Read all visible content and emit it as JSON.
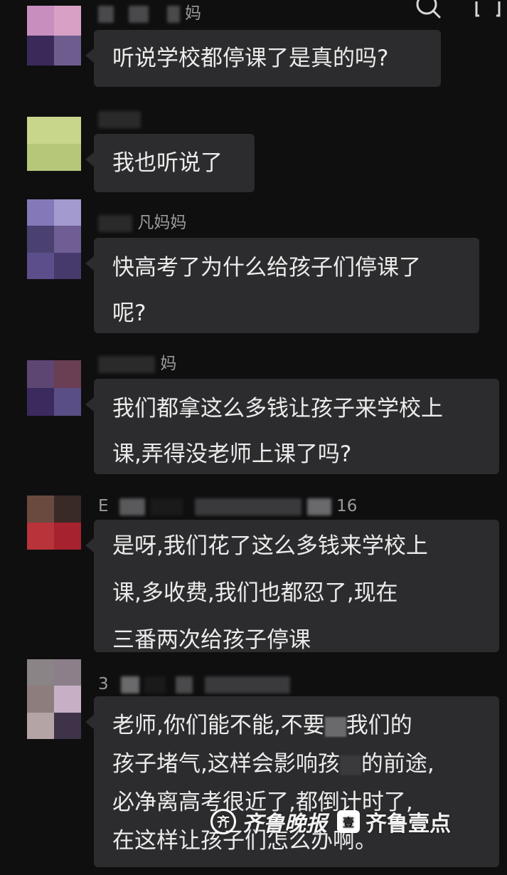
{
  "header": {
    "search_icon": "search-icon",
    "menu_icon": "person-icon"
  },
  "messages": [
    {
      "nickname_visible": "妈",
      "lines": [
        "听说学校都停课了是真的吗?"
      ],
      "avatar_colors": [
        "#c88fbe",
        "#d7a0c4",
        "#3a2a5a",
        "#6f5c8e"
      ]
    },
    {
      "nickname_visible": "",
      "lines": [
        "我也听说了"
      ],
      "avatar_colors": [
        "#c7d68b",
        "#c7d68b",
        "#b6c77a",
        "#b6c77a"
      ]
    },
    {
      "nickname_visible": "凡妈妈",
      "lines": [
        "快高考了为什么给孩子们停课了",
        "呢?"
      ],
      "avatar_colors": [
        "#8478b8",
        "#a39ad0",
        "#4b4170",
        "#6e5e94",
        "#5c4e8a",
        "#463a6c"
      ]
    },
    {
      "nickname_visible": "妈",
      "lines": [
        "我们都拿这么多钱让孩子来学校上",
        "课,弄得没老师上课了吗?"
      ],
      "avatar_colors": [
        "#5e4673",
        "#6a3f53",
        "#3b2a5e",
        "#5a4e86"
      ]
    },
    {
      "nickname_visible": "16",
      "nickname_prefix": "E",
      "lines": [
        "是呀,我们花了这么多钱来学校上",
        "课,多收费,我们也都忍了,现在",
        "三番两次给孩子停课"
      ],
      "avatar_colors": [
        "#6a4a3e",
        "#3a2a26",
        "#b8333a",
        "#a5222e"
      ]
    },
    {
      "nickname_visible": "",
      "nickname_prefix": "3",
      "lines": [
        "老师,你们能不能,不要",
        "孩子堵气,这样会影响孩",
        "必净离高考很近了,都倒计时了,",
        "在这样让孩子们怎么办啊。"
      ],
      "line_tails": [
        "我们的",
        "的前途,",
        "",
        ""
      ],
      "avatar_colors": [
        "#8a8486",
        "#8c7f8a",
        "#8d7d7c",
        "#c7b0c6",
        "#b4a4a6",
        "#3e3348"
      ]
    }
  ],
  "watermark": {
    "logo_text": "齐",
    "brand_text": "齐鲁晚报",
    "badge_text": "壹",
    "app_text": "齐鲁壹点"
  }
}
